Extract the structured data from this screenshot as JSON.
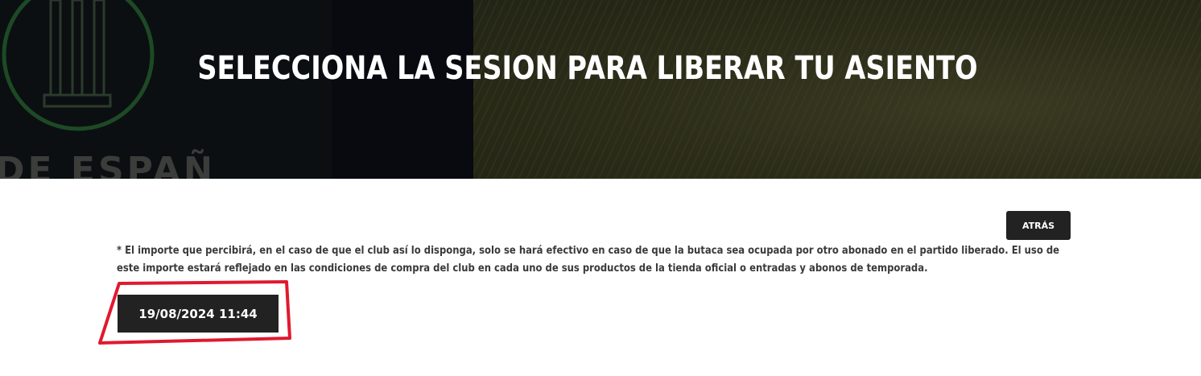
{
  "hero": {
    "title": "SELECCIONA LA SESION PARA LIBERAR TU ASIENTO",
    "background_text": "DE ESPAÑA",
    "accent_color": "#1f5a2a"
  },
  "toolbar": {
    "back_label": "ATRÁS"
  },
  "notice": {
    "text": "* El importe que percibirá, en el caso de que el club así lo disponga, solo se hará efectivo en caso de que la butaca sea ocupada por otro abonado en el partido liberado. El uso de este importe estará reflejado en las condiciones de compra del club en cada uno de sus productos de la tienda oficial o entradas y abonos de temporada."
  },
  "sessions": [
    {
      "label": "19/08/2024 11:44"
    }
  ],
  "annotation": {
    "color": "#e0192e"
  }
}
